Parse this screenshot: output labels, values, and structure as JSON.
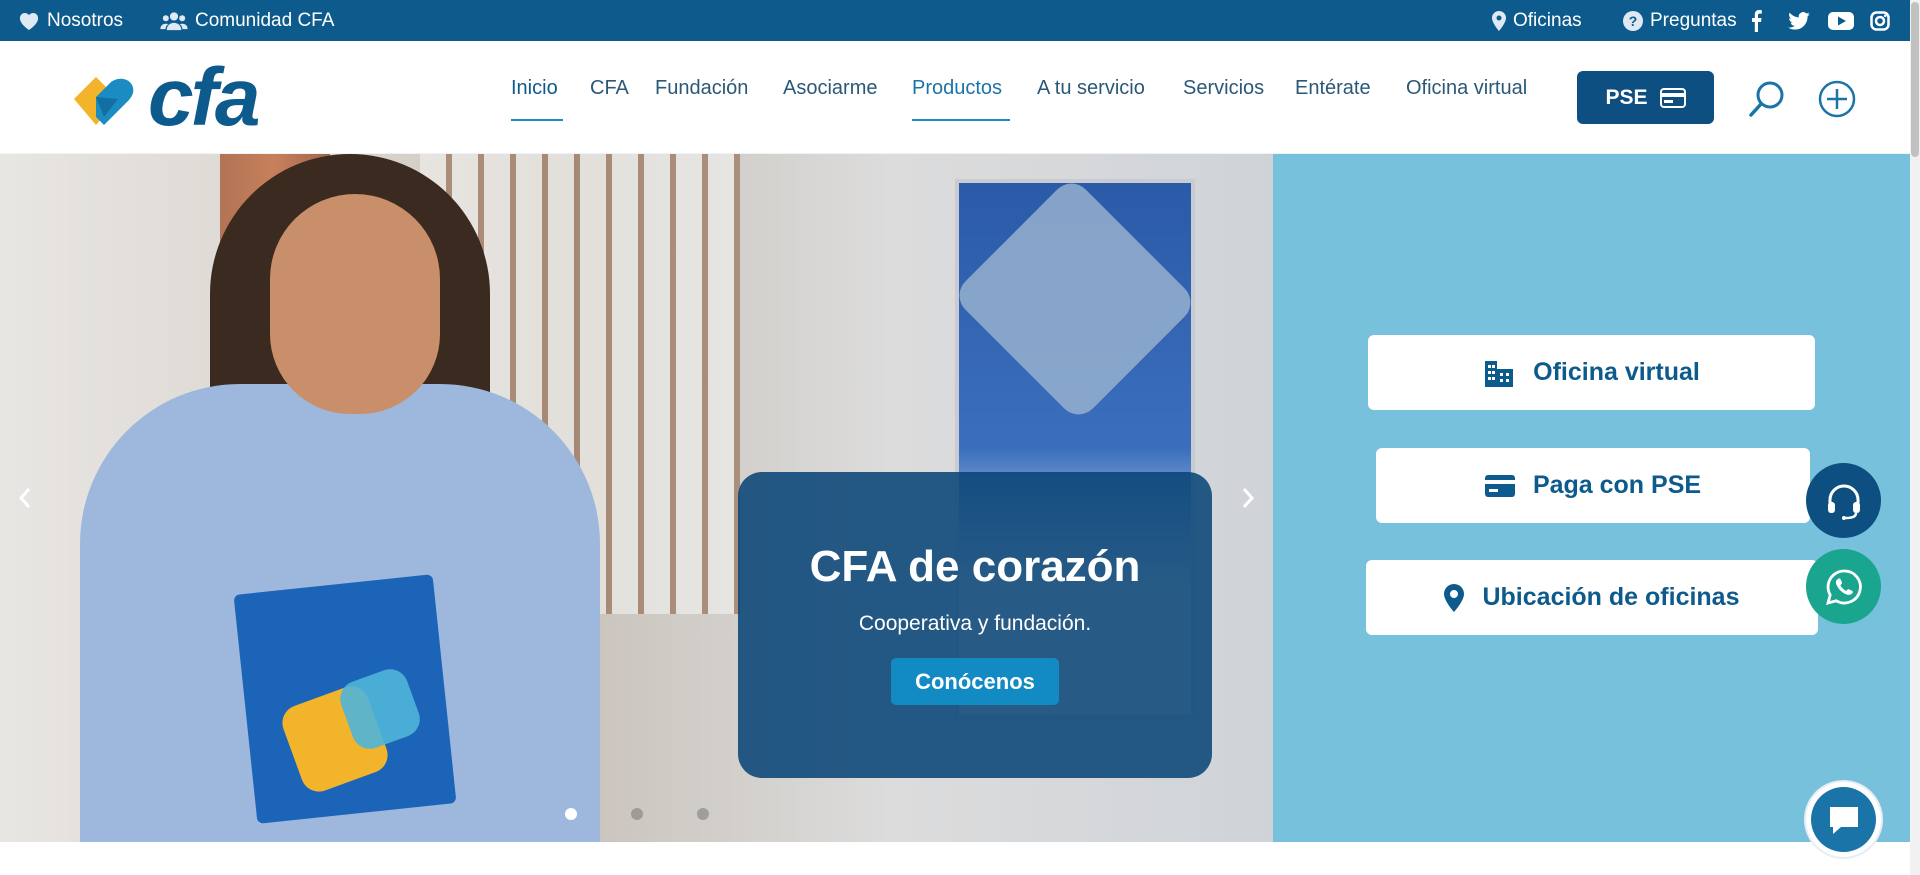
{
  "topbar": {
    "nosotros": "Nosotros",
    "comunidad": "Comunidad CFA",
    "oficinas": "Oficinas",
    "preguntas": "Preguntas"
  },
  "brand": {
    "logo_text": "cfa"
  },
  "nav": {
    "items": [
      "Inicio",
      "CFA",
      "Fundación",
      "Asociarme",
      "Productos",
      "A tu servicio",
      "Servicios",
      "Entérate",
      "Oficina virtual"
    ],
    "pse_label": "PSE"
  },
  "hero": {
    "title": "CFA de corazón",
    "subtitle": "Cooperativa y fundación.",
    "button": "Conócenos",
    "slide_count": 3,
    "active_slide": 1
  },
  "quick_links": {
    "oficina_virtual": "Oficina virtual",
    "paga_pse": "Paga con PSE",
    "ubicacion": "Ubicación de oficinas"
  },
  "colors": {
    "top_bar": "#0d5a8d",
    "brand_blue": "#0d4f80",
    "accent_yellow": "#f2b42a",
    "panel_bg": "#78c1dc",
    "whatsapp": "#1aa58f"
  }
}
